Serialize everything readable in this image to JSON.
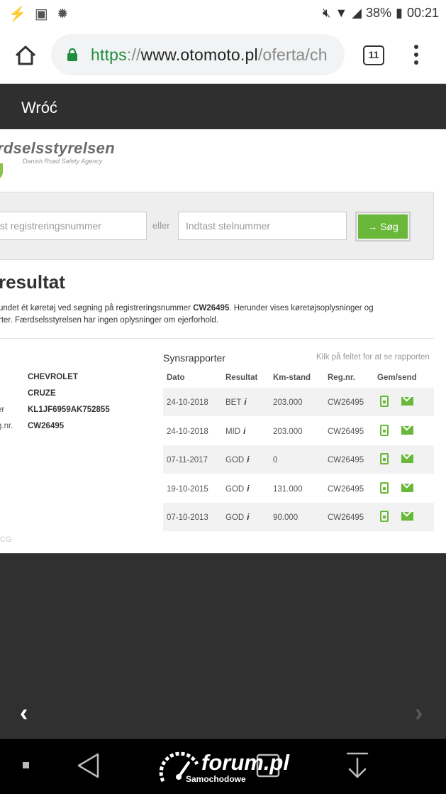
{
  "status_bar": {
    "battery": "38%",
    "time": "00:21"
  },
  "browser": {
    "url_scheme": "https",
    "url_sep": "://",
    "url_host": "www.otomoto.pl",
    "url_path": "/oferta/ch",
    "tab_count": "11"
  },
  "header": {
    "back_label": "Wróć"
  },
  "page": {
    "logo_title": "rdselsstyrelsen",
    "logo_subtitle": "Danish Road Safety Agency",
    "reg_placeholder": "ast registreringsnummer",
    "eller": "eller",
    "stel_placeholder": "Indtast stelnummer",
    "search_button": "→ Søg",
    "result_title": "resultat",
    "result_line1_pre": "undet ét køretøj ved søgning på registreringsnummer ",
    "result_reg_bold": "CW26495",
    "result_line1_post": ". Herunder vises køretøjsoplysninger og",
    "result_line2": "rter. Færdselsstyrelsen har ingen oplysninger om ejerforhold.",
    "vehicle": [
      {
        "label": "",
        "value": "CHEVROLET"
      },
      {
        "label": "",
        "value": "CRUZE"
      },
      {
        "label": "er",
        "value": "KL1JF6959AK752855"
      },
      {
        "label": "g.nr.",
        "value": "CW26495"
      }
    ],
    "faded_text": "CG",
    "syns_title": "Synsrapporter",
    "syns_hint": "Klik på feltet for at se rapporten",
    "table_headers": [
      "Dato",
      "Resultat",
      "Km-stand",
      "Reg.nr.",
      "Gem/send"
    ],
    "rows": [
      {
        "dato": "24-10-2018",
        "resultat": "BET",
        "km": "203.000",
        "reg": "CW26495"
      },
      {
        "dato": "24-10-2018",
        "resultat": "MID",
        "km": "203.000",
        "reg": "CW26495"
      },
      {
        "dato": "07-11-2017",
        "resultat": "GOD",
        "km": "0",
        "reg": "CW26495"
      },
      {
        "dato": "19-10-2015",
        "resultat": "GOD",
        "km": "131.000",
        "reg": "CW26495"
      },
      {
        "dato": "07-10-2013",
        "resultat": "GOD",
        "km": "90.000",
        "reg": "CW26495"
      }
    ],
    "info_glyph": "i"
  },
  "nav": {
    "prev": "‹",
    "next": "›"
  },
  "watermark": {
    "forum": "forum.pl",
    "sub": "Samochodowe"
  },
  "colors": {
    "accent_green": "#69b83a",
    "header_bg": "#2f2f2f"
  }
}
